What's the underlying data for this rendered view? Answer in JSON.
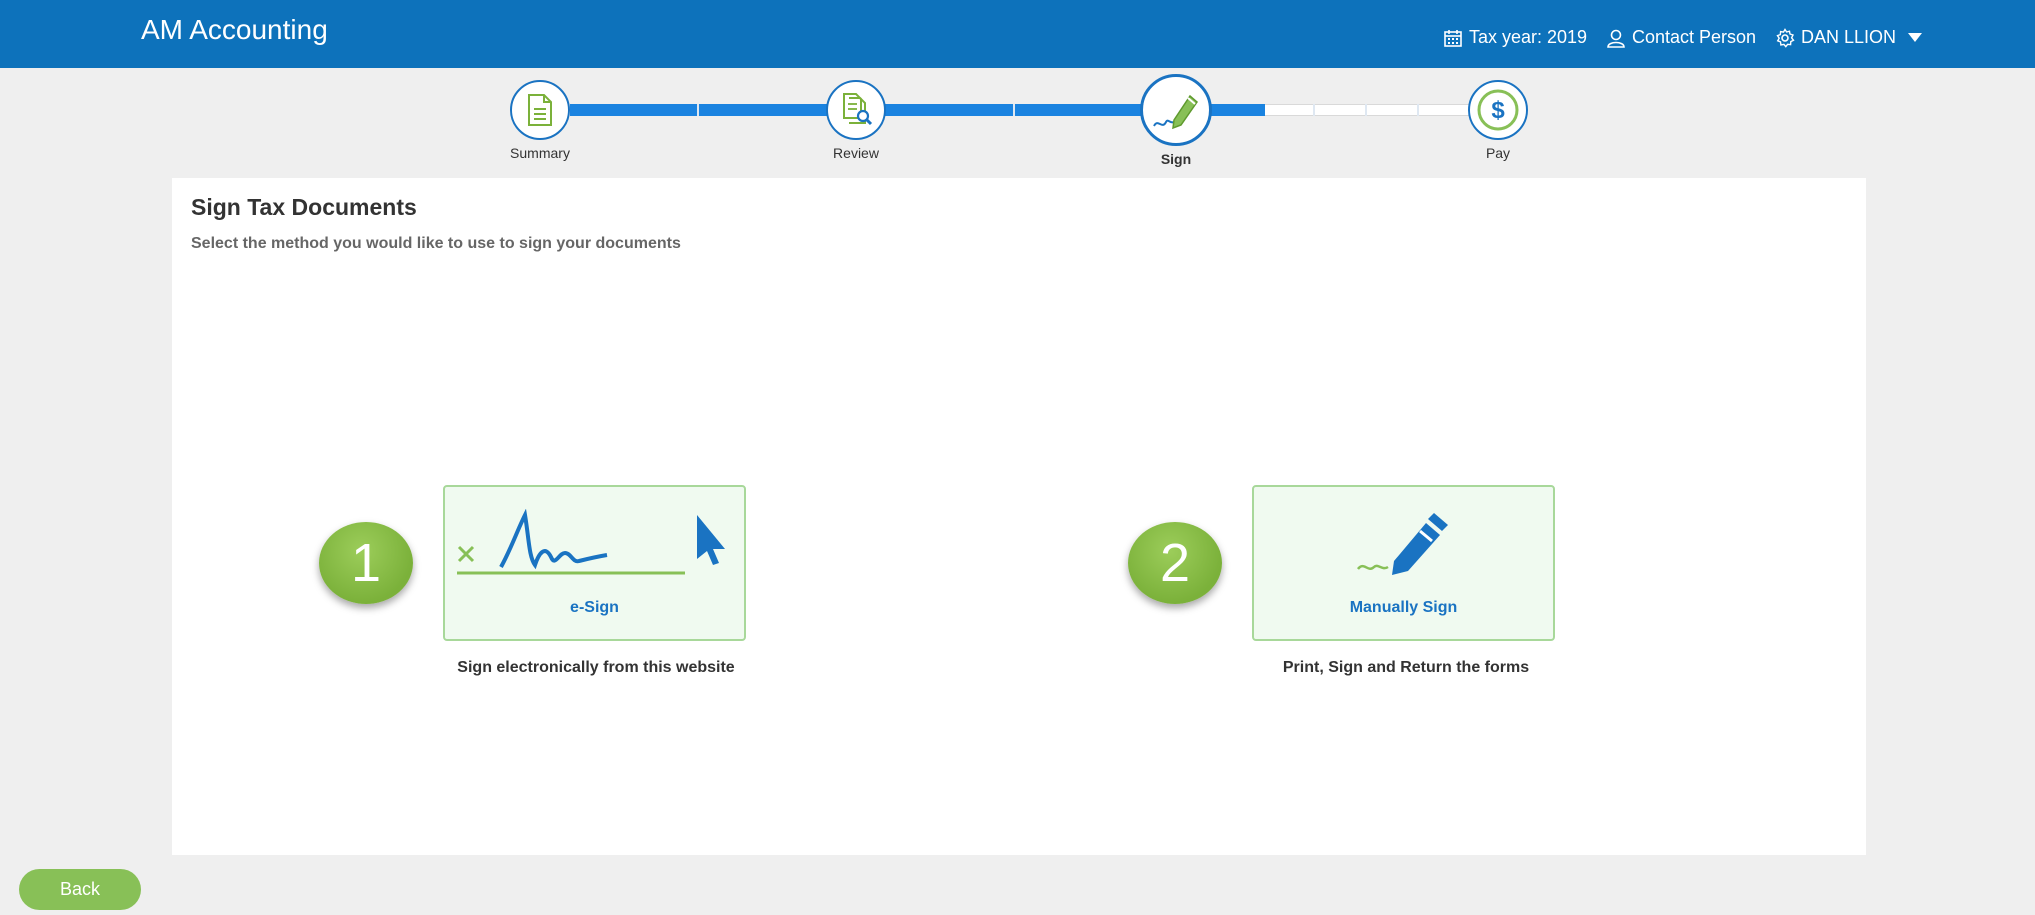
{
  "header": {
    "brand": "AM Accounting",
    "tax_year": "Tax year: 2019",
    "contact": "Contact Person",
    "user": "DAN LLION",
    "color": "#0d72bb"
  },
  "stepper": {
    "steps": [
      {
        "label": "Summary",
        "icon": "document-icon",
        "state": "done"
      },
      {
        "label": "Review",
        "icon": "review-document-icon",
        "state": "done"
      },
      {
        "label": "Sign",
        "icon": "pen-sign-icon",
        "state": "active"
      },
      {
        "label": "Pay",
        "icon": "dollar-icon",
        "state": "pending"
      }
    ],
    "progress_color": "#1a83e0"
  },
  "page": {
    "title": "Sign Tax Documents",
    "subtitle": "Select the method you would like to use to sign your documents"
  },
  "options": [
    {
      "number": "1",
      "title": "e-Sign",
      "description": "Sign electronically from this website",
      "icon": "e-signature-icon"
    },
    {
      "number": "2",
      "title": "Manually Sign",
      "description": "Print, Sign and Return the forms",
      "icon": "pen-icon"
    }
  ],
  "footer": {
    "back_label": "Back",
    "accent": "#88c057"
  }
}
